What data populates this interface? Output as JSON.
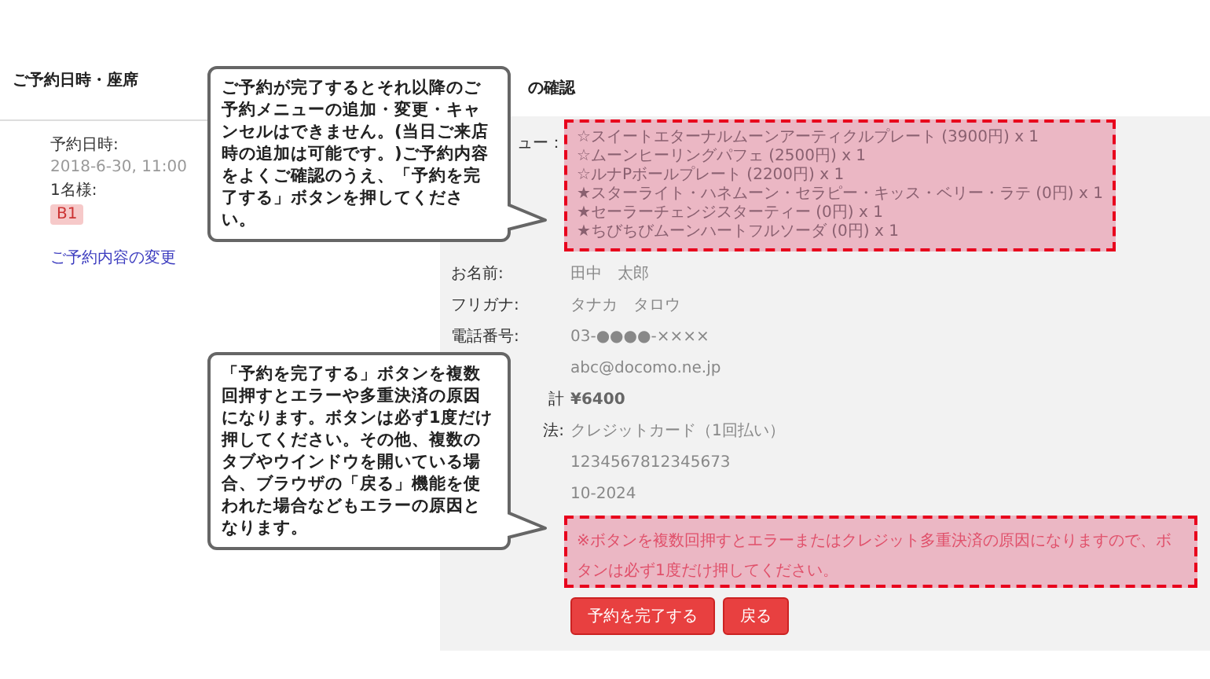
{
  "left": {
    "title": "ご予約日時・座席",
    "datetime_label": "予約日時:",
    "datetime": "2018-6-30, 11:00",
    "seats_label": "1名様:",
    "seat_badge": "B1",
    "change_link": "ご予約内容の変更"
  },
  "right": {
    "title": "の確認",
    "rows": [
      {
        "kind": "menu",
        "label": "ュー：",
        "label_covered": true,
        "items": [
          "☆スイートエターナルムーンアーティクルプレート (3900円) x 1",
          "☆ムーンヒーリングパフェ (2500円) x 1",
          "☆ルナPボールプレート (2200円) x 1",
          "★スターライト・ハネムーン・セラピー・キッス・ベリー・ラテ (0円) x 1",
          "★セーラーチェンジスターティー (0円) x 1",
          "★ちびちびムーンハートフルソーダ (0円) x 1"
        ]
      },
      {
        "kind": "field",
        "label": "お名前:",
        "label_covered": false,
        "value": "田中　太郎"
      },
      {
        "kind": "field",
        "label": "フリガナ:",
        "label_covered": false,
        "value": "タナカ　タロウ"
      },
      {
        "kind": "field",
        "label": "電話番号:",
        "label_covered": false,
        "value": "03-●●●●-××××"
      },
      {
        "kind": "field",
        "value": "abc@docomo.ne.jp"
      },
      {
        "kind": "total",
        "label": "計",
        "label_covered": true,
        "value": "¥6400"
      },
      {
        "kind": "field",
        "label": "法:",
        "label_covered": true,
        "value": "クレジットカード（1回払い）"
      },
      {
        "kind": "field",
        "value": "1234567812345673"
      },
      {
        "kind": "field",
        "value": "10-2024"
      }
    ],
    "warning": "※ボタンを複数回押すとエラーまたはクレジット多重決済の原因になりますので、ボタンは必ず1度だけ押してください。",
    "buttons": [
      {
        "label": "予約を完了する"
      },
      {
        "label": "戻る"
      }
    ]
  },
  "callouts": [
    {
      "text": "ご予約が完了するとそれ以降のご予約メニューの追加・変更・キャンセルはできません。(当日ご来店時の追加は可能です。)ご予約内容をよくご確認のうえ、「予約を完了する」ボタンを押してください。"
    },
    {
      "text": "「予約を完了する」ボタンを複数回押すとエラーや多重決済の原因になります。ボタンは必ず1度だけ押してください。その他、複数のタブやウインドウを開いている場合、ブラウザの「戻る」機能を使われた場合などもエラーの原因となります。"
    }
  ]
}
